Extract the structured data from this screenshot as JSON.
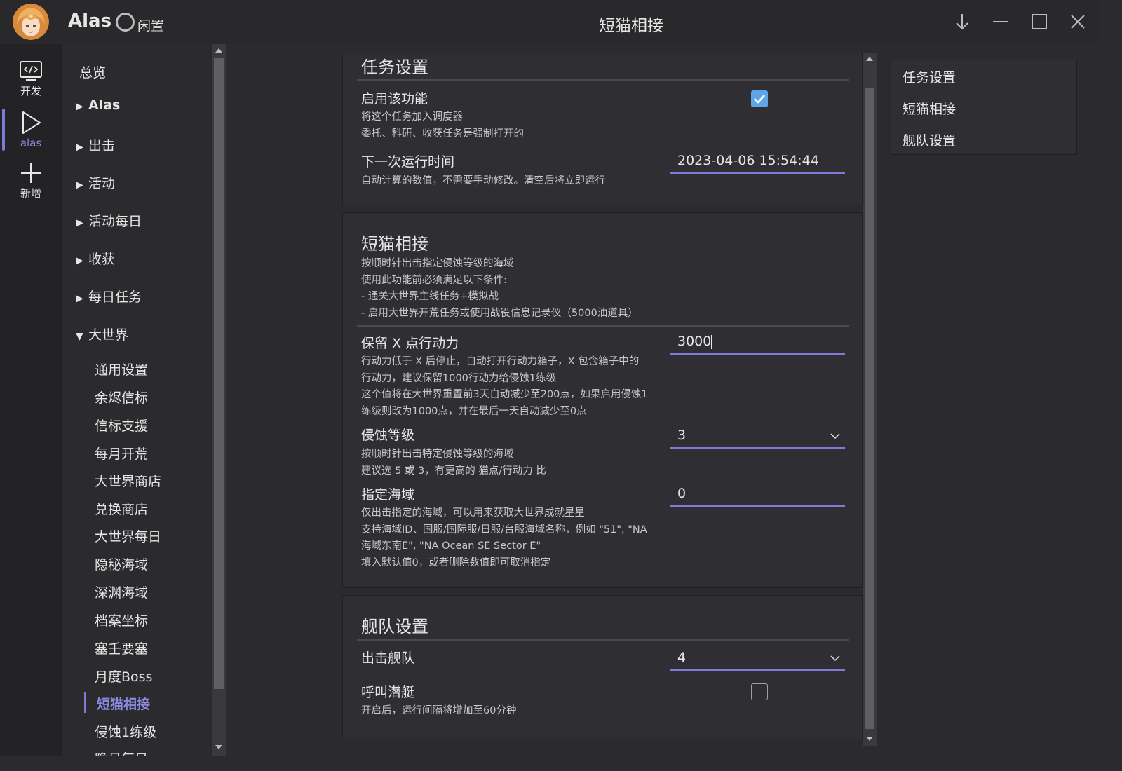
{
  "app": {
    "name": "Alas",
    "status": "闲置",
    "window_title": "短猫相接"
  },
  "rail": [
    {
      "label": "开发",
      "icon": "code-window-icon"
    },
    {
      "label": "alas",
      "icon": "play-icon"
    },
    {
      "label": "新增",
      "icon": "plus-icon"
    }
  ],
  "nav": {
    "overview": "总览",
    "groups": [
      "Alas",
      "出击",
      "活动",
      "活动每日",
      "收获",
      "每日任务"
    ],
    "expanded_group": "大世界",
    "sub_items": [
      "通用设置",
      "余烬信标",
      "信标支援",
      "每月开荒",
      "大世界商店",
      "兑换商店",
      "大世界每日",
      "隐秘海域",
      "深渊海域",
      "档案坐标",
      "塞壬要塞",
      "月度Boss",
      "短猫相接",
      "侵蚀1练级",
      "隐月每日"
    ]
  },
  "task_settings": {
    "title": "任务设置",
    "enable_label": "启用该功能",
    "enable_help": [
      "将这个任务加入调度器",
      "委托、科研、收获任务是强制打开的"
    ],
    "enable_checked": true,
    "next_run_label": "下一次运行时间",
    "next_run_value": "2023-04-06 15:54:44",
    "next_run_help": "自动计算的数值，不需要手动修改。清空后将立即运行"
  },
  "short_cat": {
    "title": "短猫相接",
    "desc": [
      "按顺时针出击指定侵蚀等级的海域",
      "使用此功能前必须满足以下条件:",
      "- 通关大世界主线任务+模拟战",
      "- 启用大世界开荒任务或使用战役信息记录仪（5000油道具）"
    ],
    "keep_ap_label": "保留 X 点行动力",
    "keep_ap_value": "3000",
    "keep_ap_help": [
      "行动力低于 X 后停止，自动打开行动力箱子，X 包含箱子中的",
      "行动力，建议保留1000行动力给侵蚀1练级",
      "这个值将在大世界重置前3天自动减少至200点，如果启用侵蚀1",
      "练级则改为1000点，并在最后一天自动减少至0点"
    ],
    "hazard_label": "侵蚀等级",
    "hazard_value": "3",
    "hazard_help": [
      "按顺时针出击特定侵蚀等级的海域",
      "建议选 5 或 3，有更高的 猫点/行动力 比"
    ],
    "zone_label": "指定海域",
    "zone_value": "0",
    "zone_help": [
      "仅出击指定的海域，可以用来获取大世界成就星星",
      "支持海域ID、国服/国际服/日服/台服海域名称，例如 \"51\", \"NA",
      "海域东南E\", \"NA Ocean SE Sector E\"",
      "填入默认值0，或者删除数值即可取消指定"
    ]
  },
  "fleet": {
    "title": "舰队设置",
    "fleet_label": "出击舰队",
    "fleet_value": "4",
    "submarine_label": "呼叫潜艇",
    "submarine_checked": false,
    "submarine_help": "开启后，运行间隔将增加至60分钟"
  },
  "outline": [
    "任务设置",
    "短猫相接",
    "舰队设置"
  ],
  "colors": {
    "accent": "#7f7bd8",
    "checkbox": "#5ea5ea",
    "background": "#2b2b2e"
  }
}
